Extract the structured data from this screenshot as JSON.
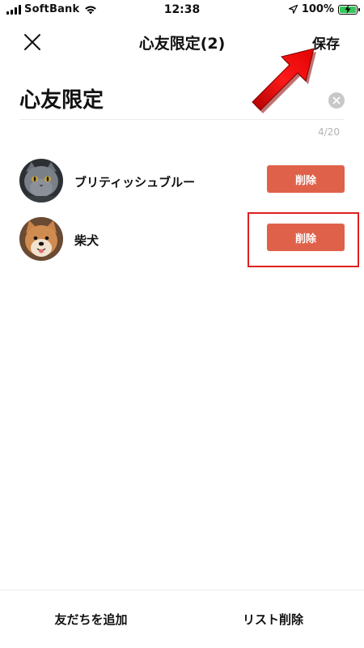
{
  "status_bar": {
    "carrier": "SoftBank",
    "time": "12:38",
    "battery_percent": "100%",
    "battery_level": 1.0,
    "icons": [
      "signal-icon",
      "wifi-icon",
      "location-arrow-icon",
      "battery-charging-icon"
    ]
  },
  "header": {
    "title": "心友限定(2)",
    "save_label": "保存",
    "close_icon": "close-icon"
  },
  "list_name": {
    "value": "心友限定",
    "counter": "4/20",
    "clear_icon": "clear-circle-icon"
  },
  "members": [
    {
      "name": "ブリティッシュブルー",
      "avatar": "british-blue-cat-avatar",
      "delete_label": "削除"
    },
    {
      "name": "柴犬",
      "avatar": "shiba-inu-avatar",
      "delete_label": "削除"
    }
  ],
  "bottom_bar": {
    "add_friends_label": "友だちを追加",
    "delete_list_label": "リスト削除"
  },
  "colors": {
    "delete_button": "#e0614a",
    "annotation": "#e02020",
    "battery": "#35c759"
  }
}
